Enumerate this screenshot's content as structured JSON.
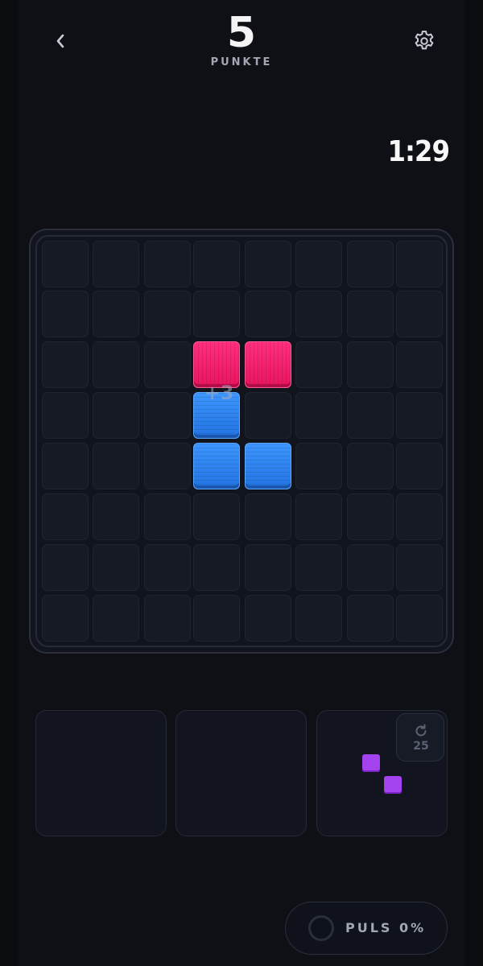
{
  "header": {
    "back_icon": "chevron-left-icon",
    "settings_icon": "gear-icon",
    "score": "5",
    "score_label": "PUNKTE"
  },
  "timer": "1:29",
  "board": {
    "rows": 8,
    "cols": 8,
    "placed_blocks": [
      {
        "row": 2,
        "col": 3,
        "color": "pink"
      },
      {
        "row": 2,
        "col": 4,
        "color": "pink"
      },
      {
        "row": 3,
        "col": 3,
        "color": "blue"
      },
      {
        "row": 4,
        "col": 3,
        "color": "blue"
      },
      {
        "row": 4,
        "col": 4,
        "color": "blue"
      }
    ],
    "score_popup": "+3"
  },
  "colors": {
    "pink": "#f0206a",
    "blue": "#2f86f2",
    "purple": "#a542f0",
    "background": "#0e1016"
  },
  "trays": {
    "slots": [
      {
        "piece": null
      },
      {
        "piece": null
      },
      {
        "piece": "purple-diagonal-2"
      }
    ],
    "rotate": {
      "icon": "rotate-icon",
      "count": "25"
    }
  },
  "pulse": {
    "label": "PULS 0%",
    "value": 0
  }
}
